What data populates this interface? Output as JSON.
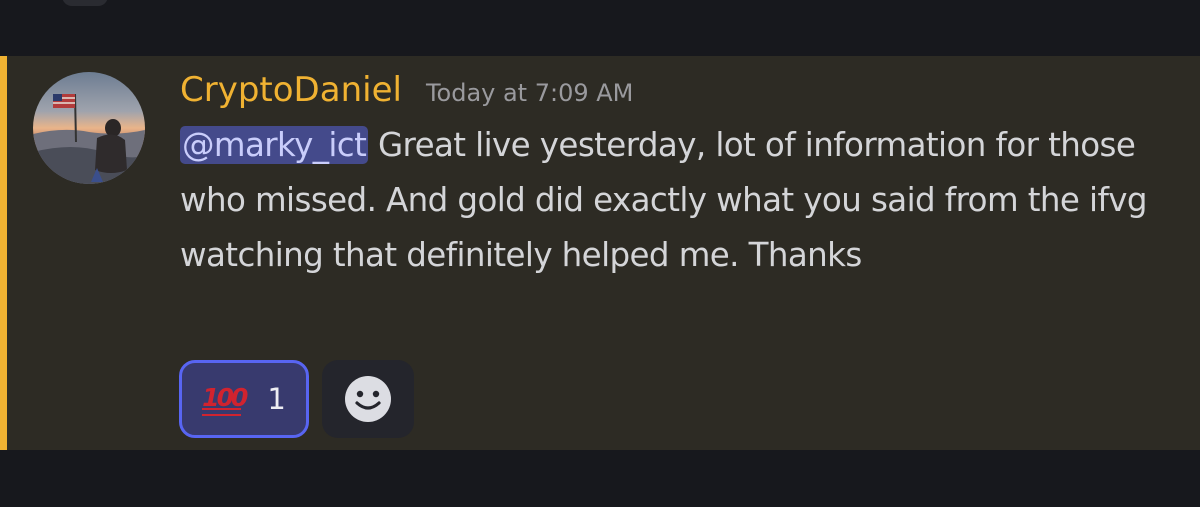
{
  "message": {
    "author": "CryptoDaniel",
    "timestamp": "Today at 7:09 AM",
    "mention": "@marky_ict",
    "text": " Great live yesterday, lot of information for those who missed. And gold did exactly what you said from the ifvg watching that definitely helped me. Thanks",
    "avatar_icon": "avatar-photo-person-with-flag"
  },
  "reactions": [
    {
      "emoji": "100-emoji-icon",
      "emoji_text": "100",
      "count": "1",
      "selected": true
    }
  ],
  "add_reaction_icon": "smile-icon",
  "colors": {
    "background": "#17181d",
    "message_highlight": "#2d2b24",
    "highlight_bar": "#f0b232",
    "username": "#f0b232",
    "mention_bg": "#444a8b",
    "reaction_border": "#5865f2"
  }
}
